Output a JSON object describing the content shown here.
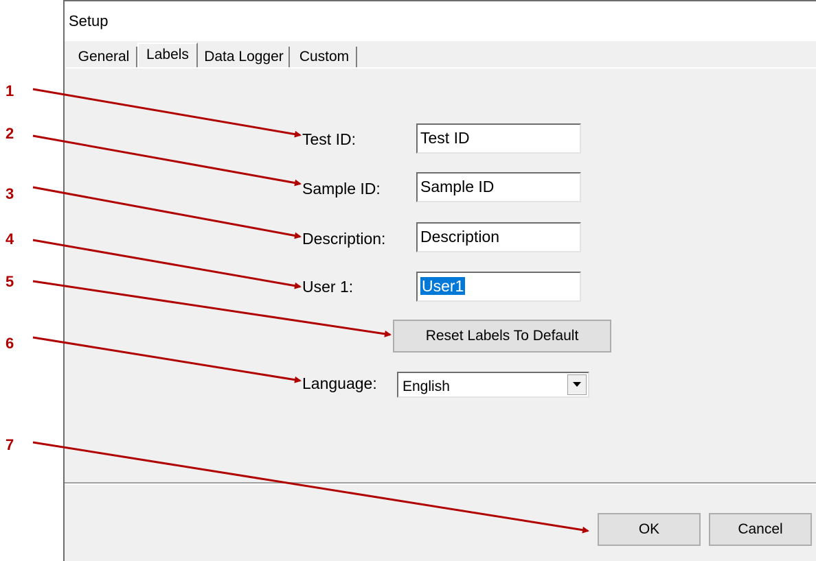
{
  "window": {
    "title": "Setup"
  },
  "tabs": [
    {
      "label": "General",
      "active": false
    },
    {
      "label": "Labels",
      "active": true
    },
    {
      "label": "Data Logger",
      "active": false
    },
    {
      "label": "Custom",
      "active": false
    }
  ],
  "fields": {
    "test_id": {
      "label": "Test ID:",
      "value": "Test ID"
    },
    "sample_id": {
      "label": "Sample ID:",
      "value": "Sample ID"
    },
    "description": {
      "label": "Description:",
      "value": "Description"
    },
    "user1": {
      "label": "User 1:",
      "value": "User1"
    }
  },
  "reset_button": {
    "label": "Reset Labels To Default"
  },
  "language": {
    "label": "Language:",
    "selected": "English",
    "icon": "chevron-down-icon"
  },
  "footer": {
    "ok_label": "OK",
    "cancel_label": "Cancel"
  },
  "callouts": [
    "1",
    "2",
    "3",
    "4",
    "5",
    "6",
    "7"
  ],
  "colors": {
    "callout": "#b00000",
    "selection": "#0078d7",
    "window_bg": "#f0f0f0"
  }
}
